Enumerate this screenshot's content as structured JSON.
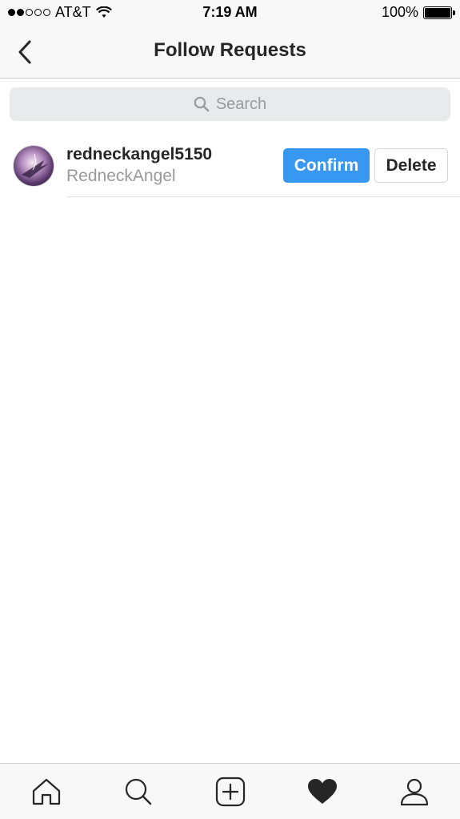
{
  "status_bar": {
    "carrier": "AT&T",
    "time": "7:19 AM",
    "battery": "100%",
    "signal_bars_filled": 2,
    "signal_bars_total": 5
  },
  "nav": {
    "title": "Follow Requests",
    "back_icon": "chevron-left-icon"
  },
  "search": {
    "placeholder": "Search",
    "icon": "search-icon"
  },
  "requests": [
    {
      "username": "redneckangel5150",
      "full_name": "RedneckAngel",
      "confirm_label": "Confirm",
      "delete_label": "Delete"
    }
  ],
  "tab_bar": {
    "tabs": [
      {
        "icon": "home-icon"
      },
      {
        "icon": "search-icon"
      },
      {
        "icon": "add-post-icon"
      },
      {
        "icon": "heart-icon",
        "active": true
      },
      {
        "icon": "profile-icon"
      }
    ]
  },
  "colors": {
    "accent": "#3897f0",
    "bar_background": "#f8f8f8",
    "search_background": "#e9eaeb",
    "secondary_text": "#999999"
  }
}
